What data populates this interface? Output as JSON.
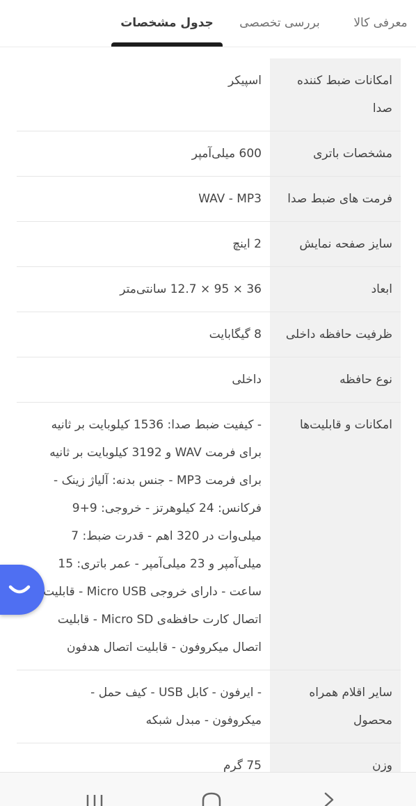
{
  "tabs": {
    "intro": "معرفی کالا",
    "review": "بررسی تخصصی",
    "specs": "جدول مشخصات"
  },
  "specs": [
    {
      "key": "امکانات ضبط کننده صدا",
      "value": "اسپیکر"
    },
    {
      "key": "مشخصات باتری",
      "value": "600 میلی‌آمپر"
    },
    {
      "key": "فرمت های ضبط صدا",
      "value": "WAV - MP3"
    },
    {
      "key": "سایز صفحه نمایش",
      "value": "2 اینچ"
    },
    {
      "key": "ابعاد",
      "value": "36 × 95 × 12.7 سانتی‌متر"
    },
    {
      "key": "ظرفیت حافظه داخلی",
      "value": "8 گیگابایت"
    },
    {
      "key": "نوع حافظه",
      "value": "داخلی"
    },
    {
      "key": "امکانات و قابلیت‌ها",
      "value": "- کیفیت ضبط صدا: 1536 کیلوبایت بر ثانیه برای فرمت WAV و 3192 کیلوبایت بر ثانیه برای فرمت MP3 - جنس بدنه: آلیاژ زینک - فرکانس: 24 کیلوهرتز - خروجی: 9+9 میلی‌وات در 320 اهم - قدرت ضبط: 7 میلی‌آمپر و 23 میلی‌آمپر - عمر باتری: 15 ساعت - دارای خروجی Micro USB - قابلیت اتصال کارت حافظه‌ی Micro SD - قابلیت اتصال میکروفون - قابلیت اتصال هدفون"
    },
    {
      "key": "سایر اقلام همراه محصول",
      "value": "- ایرفون - کابل USB - کیف حمل - میکروفون - مبدل شبکه"
    },
    {
      "key": "وزن",
      "value": "75 گرم"
    }
  ],
  "colors": {
    "accent": "#4f6ff2",
    "tab_indicator": "#1d1d1d",
    "key_background": "#f1f1f1"
  },
  "icons": {
    "chat": "chat-smile-icon",
    "nav_recent": "recent-apps-icon",
    "nav_home": "home-icon",
    "nav_back": "back-icon"
  }
}
